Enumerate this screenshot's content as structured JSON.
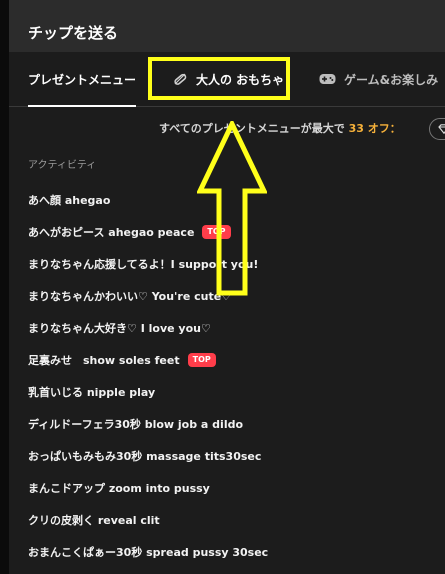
{
  "header": {
    "title": "チップを送る"
  },
  "tabs": [
    {
      "label": "プレゼントメニュー",
      "active": true
    },
    {
      "label": "大人の おもちゃ",
      "icon": "toy-icon"
    },
    {
      "label": "ゲーム&お楽しみ",
      "icon": "gamepad-icon"
    }
  ],
  "discount": {
    "prefix": "すべてのプレゼントメニューが最大で",
    "percent": "33",
    "suffix": "オフ："
  },
  "section": {
    "label": "アクティビティ"
  },
  "items": [
    {
      "label": "あへ顔 ahegao",
      "badge": ""
    },
    {
      "label": "あへがおピース ahegao peace",
      "badge": "TOP"
    },
    {
      "label": "まりなちゃん応援してるよ！I support you!",
      "badge": ""
    },
    {
      "label": "まりなちゃんかわいい♡ You're cute♡",
      "badge": ""
    },
    {
      "label": "まりなちゃん大好き♡ I love you♡",
      "badge": ""
    },
    {
      "label": "足裏みせ　show soles feet",
      "badge": "TOP"
    },
    {
      "label": "乳首いじる nipple play",
      "badge": ""
    },
    {
      "label": "ディルドーフェラ30秒 blow job a dildo",
      "badge": ""
    },
    {
      "label": "おっぱいもみもみ30秒 massage tits30sec",
      "badge": ""
    },
    {
      "label": "まんこドアップ zoom into pussy",
      "badge": ""
    },
    {
      "label": "クリの皮剥く reveal clit",
      "badge": ""
    },
    {
      "label": "おまんこくぱぁー30秒 spread pussy 30sec",
      "badge": ""
    }
  ],
  "colors": {
    "highlight": "#ffff1a",
    "badge": "#ff3d4a",
    "accent": "#f6b13a"
  }
}
